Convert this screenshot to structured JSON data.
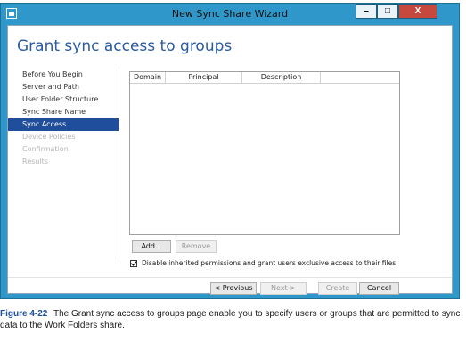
{
  "window": {
    "title": "New Sync Share Wizard",
    "minimize": "–",
    "maximize": "□",
    "close": "X"
  },
  "page": {
    "heading": "Grant sync access to groups"
  },
  "nav": {
    "items": [
      {
        "label": "Before You Begin",
        "state": "normal"
      },
      {
        "label": "Server and Path",
        "state": "normal"
      },
      {
        "label": "User Folder Structure",
        "state": "normal"
      },
      {
        "label": "Sync Share Name",
        "state": "normal"
      },
      {
        "label": "Sync Access",
        "state": "active"
      },
      {
        "label": "Device Policies",
        "state": "disabled"
      },
      {
        "label": "Confirmation",
        "state": "disabled"
      },
      {
        "label": "Results",
        "state": "disabled"
      }
    ]
  },
  "table": {
    "columns": [
      "Domain",
      "Principal",
      "Description"
    ],
    "rows": []
  },
  "buttons": {
    "add": "Add...",
    "remove": "Remove",
    "previous": "< Previous",
    "next": "Next >",
    "create": "Create",
    "cancel": "Cancel"
  },
  "checkbox": {
    "label": "Disable inherited permissions and grant users exclusive access to their files",
    "checked": true
  },
  "caption": {
    "figure": "Figure 4-22",
    "text": "The Grant sync access to groups page enable you to specify users or groups that are permitted to sync data to the Work Folders share."
  }
}
